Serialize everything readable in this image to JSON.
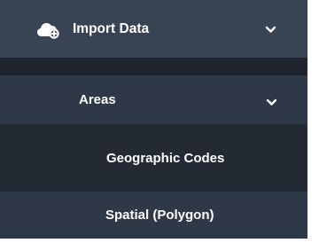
{
  "menu": {
    "import_data": {
      "label": "Import Data",
      "icon": "cloud-add-icon",
      "expanded_icon": "chevron-down-icon"
    },
    "areas": {
      "label": "Areas",
      "expanded_icon": "chevron-down-icon"
    },
    "items": [
      {
        "label": "Geographic Codes"
      },
      {
        "label": "Spatial (Polygon)"
      }
    ]
  },
  "colors": {
    "top_row_bg": "#384354",
    "strip_bg": "#1f252e",
    "areas_bg": "#2f3846",
    "geo_bg": "#242a33",
    "spatial_bg": "#2f3846",
    "text": "#ffffff"
  }
}
